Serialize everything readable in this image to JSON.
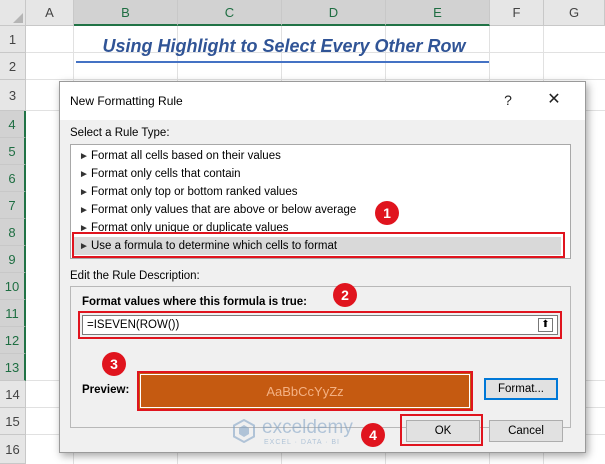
{
  "sheet": {
    "columns": [
      "A",
      "B",
      "C",
      "D",
      "E",
      "F",
      "G"
    ],
    "rows": [
      "1",
      "2",
      "3",
      "4",
      "5",
      "6",
      "7",
      "8",
      "9",
      "10",
      "11",
      "12",
      "13",
      "14",
      "15",
      "16"
    ],
    "title": "Using Highlight to Select Every Other Row"
  },
  "dialog": {
    "title": "New Formatting Rule",
    "help": "?",
    "close": "✕",
    "select_rule_label": "Select a Rule Type:",
    "rule_types": [
      "Format all cells based on their values",
      "Format only cells that contain",
      "Format only top or bottom ranked values",
      "Format only values that are above or below average",
      "Format only unique or duplicate values",
      "Use a formula to determine which cells to format"
    ],
    "selected_rule_index": 5,
    "edit_label": "Edit the Rule Description:",
    "formula_label": "Format values where this formula is true:",
    "formula_value": "=ISEVEN(ROW())",
    "collapse_icon": "⬆",
    "preview_label": "Preview:",
    "preview_sample": "AaBbCcYyZz",
    "preview_fill": "#c55a11",
    "format_button": "Format...",
    "ok_button": "OK",
    "cancel_button": "Cancel"
  },
  "annotations": {
    "badges": [
      "1",
      "2",
      "3",
      "4"
    ],
    "color": "#e0141e"
  },
  "watermark": {
    "name": "exceldemy",
    "tagline": "EXCEL · DATA · BI"
  }
}
